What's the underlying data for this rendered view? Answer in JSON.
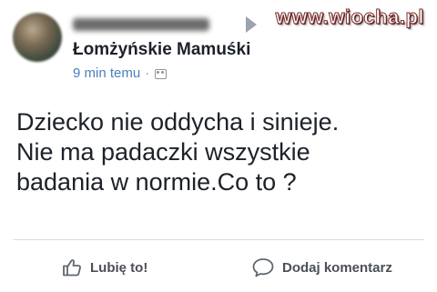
{
  "watermark": "www.wiocha.pl",
  "post": {
    "author_name": "Jo... C...ko",
    "group_name": "Łomżyńskie Mamuśki",
    "time": "9 min temu",
    "separator": "·",
    "privacy_icon": "group-icon",
    "text_lines": [
      "Dziecko nie oddycha i sinieje.",
      "Nie ma padaczki wszystkie",
      "badania w normie.Co to ?"
    ]
  },
  "actions": {
    "like": {
      "label": "Lubię to!",
      "icon": "thumbs-up-icon"
    },
    "comment": {
      "label": "Dodaj komentarz",
      "icon": "comment-icon"
    }
  }
}
